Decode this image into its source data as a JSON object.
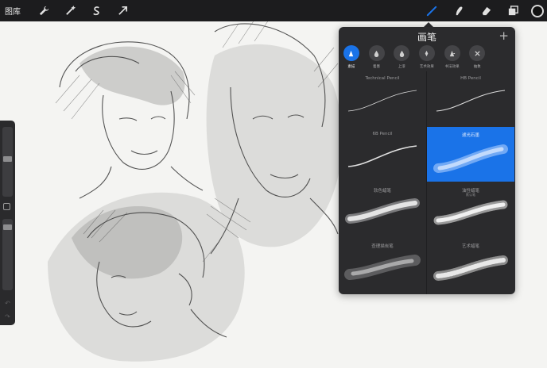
{
  "toolbar": {
    "gallery_label": "图库",
    "left_tools": [
      {
        "name": "actions-wrench-icon"
      },
      {
        "name": "adjustments-wand-icon"
      },
      {
        "name": "selection-s-icon"
      },
      {
        "name": "transform-arrow-icon"
      }
    ],
    "right_tools": [
      {
        "name": "brush-icon",
        "active": true
      },
      {
        "name": "smudge-icon"
      },
      {
        "name": "eraser-icon"
      },
      {
        "name": "layers-icon"
      }
    ],
    "current_color": "#111111",
    "accent_color": "#1a73e8"
  },
  "brush_panel": {
    "title": "画笔",
    "add_label": "+",
    "categories": [
      {
        "label": "素描",
        "icon": "pencil-icon",
        "selected": true
      },
      {
        "label": "着墨",
        "icon": "ink-drop-icon"
      },
      {
        "label": "上漆",
        "icon": "paint-drop-icon"
      },
      {
        "label": "艺术效果",
        "icon": "artistic-icon"
      },
      {
        "label": "书法效果",
        "icon": "calligraphy-icon"
      },
      {
        "label": "抽象",
        "icon": "abstract-icon"
      }
    ],
    "brushes": [
      {
        "name": "Technical Pencil",
        "sub": ""
      },
      {
        "name": "HB Pencil",
        "sub": ""
      },
      {
        "name": "6B Pencil",
        "sub": ""
      },
      {
        "name": "滤光石墨",
        "sub": "",
        "selected": true
      },
      {
        "name": "软色蜡笔",
        "sub": ""
      },
      {
        "name": "油性蜡笔",
        "sub": "默认笔"
      },
      {
        "name": "查理描炭笔",
        "sub": ""
      },
      {
        "name": "艺术蜡笔",
        "sub": ""
      }
    ]
  }
}
